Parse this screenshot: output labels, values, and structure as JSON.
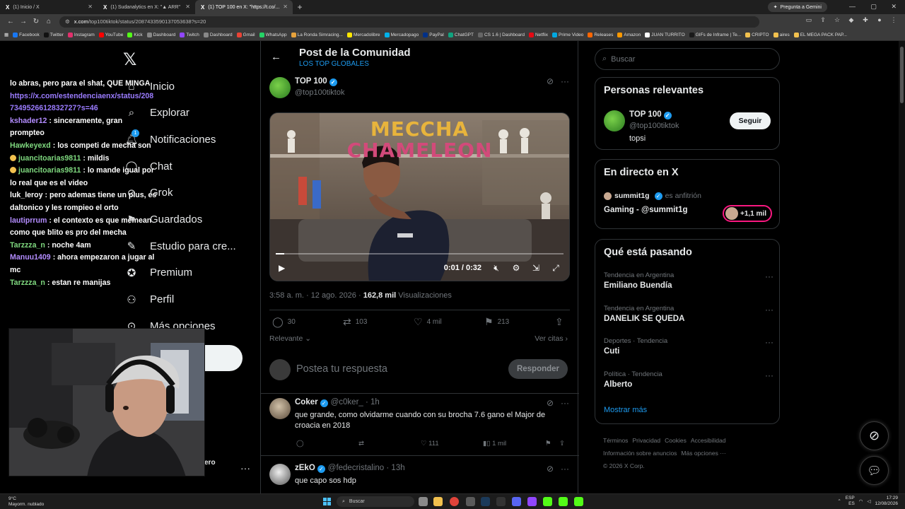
{
  "browser": {
    "tabs": [
      {
        "title": "(1) Inicio / X"
      },
      {
        "title": "(1) Sudanalytics en X: \"▲ ARR\""
      },
      {
        "title": "(1) TOP 100 en X: \"https://t.co/..."
      }
    ],
    "gemini_label": "Pregunta a Gemini",
    "url_host": "x.com",
    "url_path": "/top100tiktok/status/2087433590137053638?s=20",
    "bookmarks": [
      "Facebook",
      "Twitter",
      "Instagram",
      "YouTube",
      "Kick",
      "Dashboard",
      "Twitch",
      "Dashboard",
      "Gmail",
      "WhatsApp",
      "La Ronda Simracing...",
      "Mercadolibre",
      "Mercadopago",
      "PayPal",
      "ChatGPT",
      "CS 1.6 | Dashboard",
      "Netflix",
      "Prime Video",
      "Releases",
      "Amazon",
      "JUAN TURRITO",
      "GIFs de Inframe | Te...",
      "CRIPTO",
      "aires",
      "EL MEGA PACK PAP..."
    ]
  },
  "nav": {
    "items": [
      {
        "label": "Inicio"
      },
      {
        "label": "Explorar"
      },
      {
        "label": "Notificaciones",
        "badge": "1"
      },
      {
        "label": "Chat"
      },
      {
        "label": "Grok"
      },
      {
        "label": "Guardados"
      },
      {
        "label": "Estudio para cre..."
      },
      {
        "label": "Premium"
      },
      {
        "label": "Perfil"
      },
      {
        "label": "Más opciones"
      }
    ],
    "account_fragment": "ero"
  },
  "chat_overlay": {
    "lines": [
      {
        "user": "",
        "text": "lo abras, pero para el shat, QUE MINGA",
        "color": "#ffffff"
      },
      {
        "user": "",
        "text": "",
        "link": "https://x.com/estendenciaenx/status/2087349526612832727?s=46",
        "color": "#ffffff"
      },
      {
        "user": "kshader12",
        "text": ": sinceramente, gran prompteo",
        "color": "#b38cff"
      },
      {
        "user": "Hawkeyexd",
        "text": ": los competi de mecha son",
        "color": "#7fd97f"
      },
      {
        "user": "juancitoarias9811",
        "text": ": mildis",
        "color": "#7fd97f"
      },
      {
        "user": "juancitoarias9811",
        "text": ": lo mande igual por lo real que es el video",
        "color": "#7fd97f"
      },
      {
        "user": "luk_leroy",
        "text": ": pero ademas tiene un plus, es daltonico y les rompieo el orto",
        "color": "#ffffff"
      },
      {
        "user": "lautiprrum",
        "text": ": el contexto es que memean como que blito es pro del mecha",
        "color": "#b38cff"
      },
      {
        "user": "Tarzzza_n",
        "text": ": noche 4am",
        "color": "#7fd97f"
      },
      {
        "user": "Manuu1409",
        "text": ": ahora empezaron a jugar al mc",
        "color": "#b38cff"
      },
      {
        "user": "Tarzzza_n",
        "text": ": estan re manijas",
        "color": "#7fd97f"
      }
    ]
  },
  "post": {
    "page_title": "Post de la Comunidad",
    "community": "LOS TOP GLOBALES",
    "author_name": "TOP 100",
    "author_handle": "@top100tiktok",
    "video_sign_line1": "MECCHA",
    "video_sign_line2": "CHAMELEON",
    "video_progress": 0.03,
    "video_time": "0:01 / 0:32",
    "timestamp": "3:58 a. m. · 12 ago. 2026 · ",
    "views_count": "162,8 mil",
    "views_label": " Visualizaciones",
    "replies": "30",
    "reposts": "103",
    "likes": "4 mil",
    "bookmarks": "213",
    "sort_label": "Relevante",
    "quotes_label": "Ver citas",
    "reply_placeholder": "Postea tu respuesta",
    "reply_button": "Responder"
  },
  "comments": [
    {
      "name": "Coker",
      "handle": "@c0ker_ · 1h",
      "text": "que grande, como olvidarme cuando con su brocha 7.6 gano el Major de croacia en 2018",
      "likes": "111",
      "views": "1 mil"
    },
    {
      "name": "zEkO",
      "handle": "@fedecristalino · 13h",
      "text": "que capo sos hdp"
    }
  ],
  "sidebar": {
    "search_placeholder": "Buscar",
    "relevant_title": "Personas relevantes",
    "relevant_person": {
      "name": "TOP 100",
      "handle": "@top100tiktok",
      "bio": "topsi",
      "follow": "Seguir"
    },
    "live_title": "En directo en X",
    "live": {
      "host": "summit1g",
      "host_suffix": "es anfitrión",
      "title": "Gaming - @summit1g",
      "listeners": "+1,1 mil"
    },
    "trends_title": "Qué está pasando",
    "trends": [
      {
        "context": "Tendencia en Argentina",
        "name": "Emiliano Buendía"
      },
      {
        "context": "Tendencia en Argentina",
        "name": "DANELIK SE QUEDA"
      },
      {
        "context": "Deportes · Tendencia",
        "name": "Cuti"
      },
      {
        "context": "Política · Tendencia",
        "name": "Alberto"
      }
    ],
    "show_more": "Mostrar más",
    "footer_line1": [
      "Términos",
      "Privacidad",
      "Cookies",
      "Accesibilidad"
    ],
    "footer_line2": [
      "Información sobre anuncios",
      "Más opciones ···"
    ],
    "copyright": "© 2026 X Corp."
  },
  "taskbar": {
    "temp": "9°C",
    "weather": "Mayorm. nublado",
    "search": "Buscar",
    "lang1": "ESP",
    "lang2": "ES",
    "time": "17:29",
    "date": "12/08/2026"
  },
  "colors": {
    "accent": "#1d9bf0",
    "bg": "#000000",
    "border": "#2f3336",
    "muted": "#71767b"
  }
}
